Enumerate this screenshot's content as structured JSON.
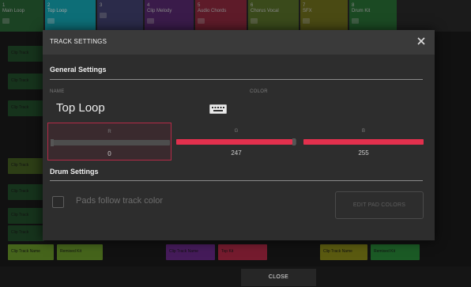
{
  "tracks": [
    {
      "num": "1",
      "name": "Main Loop",
      "color": "#2a7a3a",
      "width": 55
    },
    {
      "num": "2",
      "name": "Top Loop",
      "color": "#14a9b7",
      "width": 64
    },
    {
      "num": "3",
      "name": "",
      "color": "#4a4a8a",
      "width": 58
    },
    {
      "num": "4",
      "name": "Clip Melody",
      "color": "#6a2a8a",
      "width": 62
    },
    {
      "num": "5",
      "name": "Audio Chords",
      "color": "#b42a47",
      "width": 65
    },
    {
      "num": "6",
      "name": "Chorus Vocal",
      "color": "#6a8a2a",
      "width": 64
    },
    {
      "num": "7",
      "name": "SFX",
      "color": "#8a8a1a",
      "width": 60
    },
    {
      "num": "8",
      "name": "Drum Kit",
      "color": "#2a8a3a",
      "width": 60
    }
  ],
  "clips": {
    "col1_labels": [
      "Clip Track",
      "Clip Track",
      "Clip Track",
      "Clip Track",
      "Clip Track",
      "Clip Track",
      "Clip Track",
      "Clip Track"
    ],
    "bottom_row": [
      "Clip Track Name",
      "Remixed Kit",
      "Clip Track Name",
      "Top Kit",
      "Clip Track Name",
      "Remixed Kit"
    ]
  },
  "modal": {
    "title": "TRACK SETTINGS",
    "general_section": "General Settings",
    "name_label": "NAME",
    "name_value": "Top Loop",
    "color_label": "COLOR",
    "rgb": [
      {
        "label": "R",
        "value": "0",
        "fraction": 0
      },
      {
        "label": "G",
        "value": "247",
        "fraction": 0.969
      },
      {
        "label": "B",
        "value": "255",
        "fraction": 1.0
      }
    ],
    "drum_section": "Drum Settings",
    "pads_follow_label": "Pads follow track color",
    "pads_follow_checked": false,
    "edit_pad_colors_label": "EDIT PAD COLORS"
  },
  "footer": {
    "close_label": "CLOSE"
  },
  "colors": {
    "accent": "#e2304d",
    "selected_border": "#b42a47",
    "modal_bg": "#2d2d2d",
    "header_bg": "#3a3a3a"
  }
}
